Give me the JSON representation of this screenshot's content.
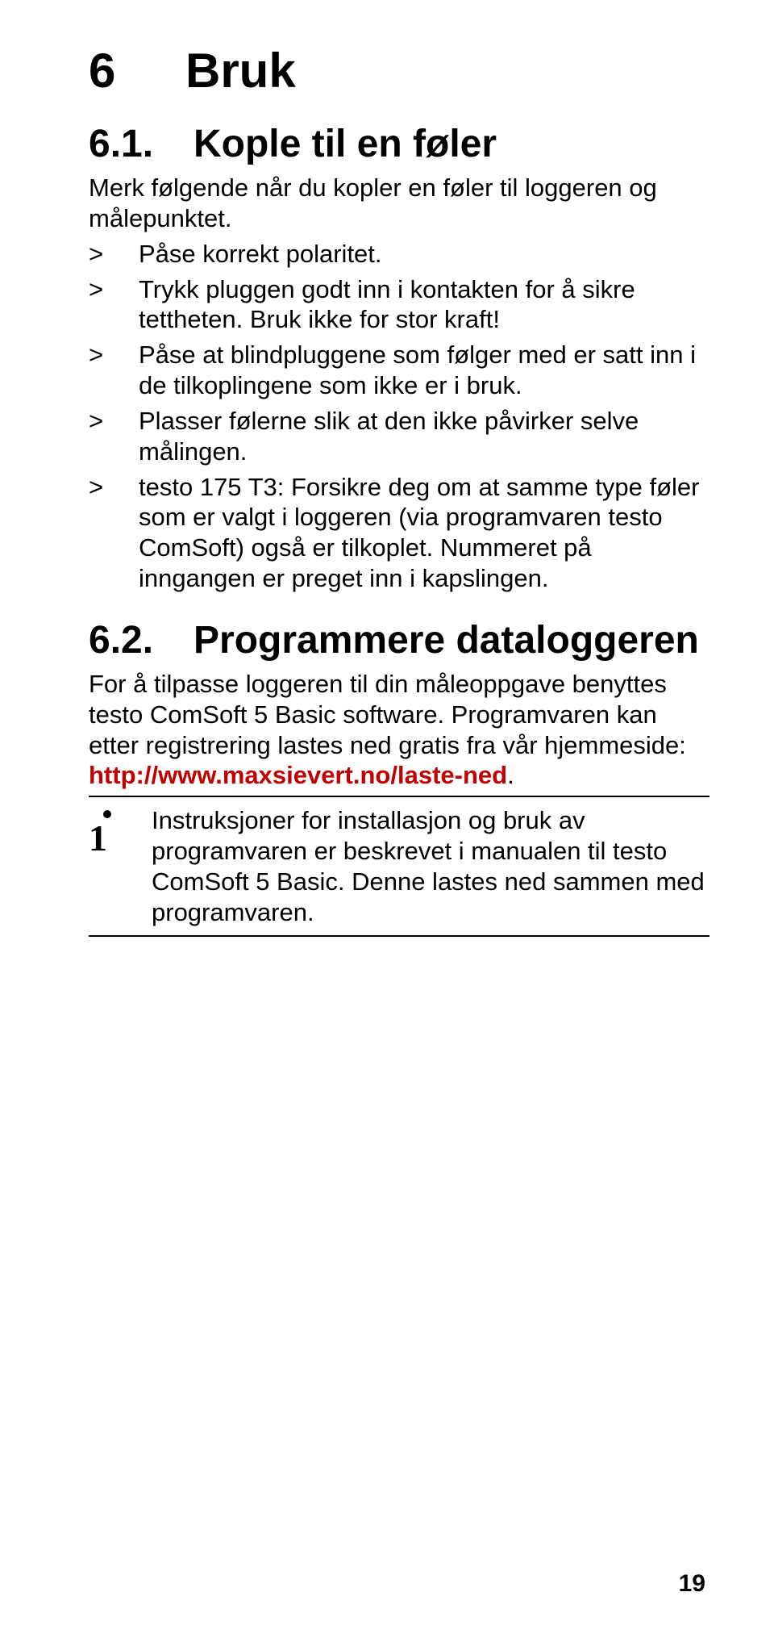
{
  "chapter": {
    "num": "6",
    "title": "Bruk"
  },
  "section1": {
    "num": "6.1.",
    "title": "Kople til en føler",
    "intro": "Merk følgende når du kopler en føler til loggeren og målepunktet.",
    "bullets": [
      "Påse korrekt polaritet.",
      "Trykk pluggen godt inn i kontakten for å sikre tettheten. Bruk ikke for stor kraft!",
      "Påse at blindpluggene som følger med er satt inn i de tilkoplingene som ikke er i bruk.",
      "Plasser følerne slik at den ikke påvirker selve målingen.",
      "testo 175 T3: Forsikre deg om at samme type føler som er valgt i loggeren (via programvaren testo ComSoft) også er tilkoplet. Nummeret på inngangen er preget inn i kapslingen."
    ]
  },
  "section2": {
    "num": "6.2.",
    "title": "Programmere dataloggeren",
    "para_before_link": "For å tilpasse loggeren til din måleoppgave benyttes testo ComSoft 5 Basic software. Programvaren kan etter registrering lastes ned gratis fra vår hjemmeside: ",
    "link_text": "http://www.maxsievert.no/laste-ned",
    "period": ".",
    "info_text": "Instruksjoner for installasjon og bruk av programvaren er beskrevet i manualen til testo ComSoft 5 Basic. Denne lastes ned sammen med programvaren."
  },
  "page_number": "19",
  "bullet_marker": ">"
}
